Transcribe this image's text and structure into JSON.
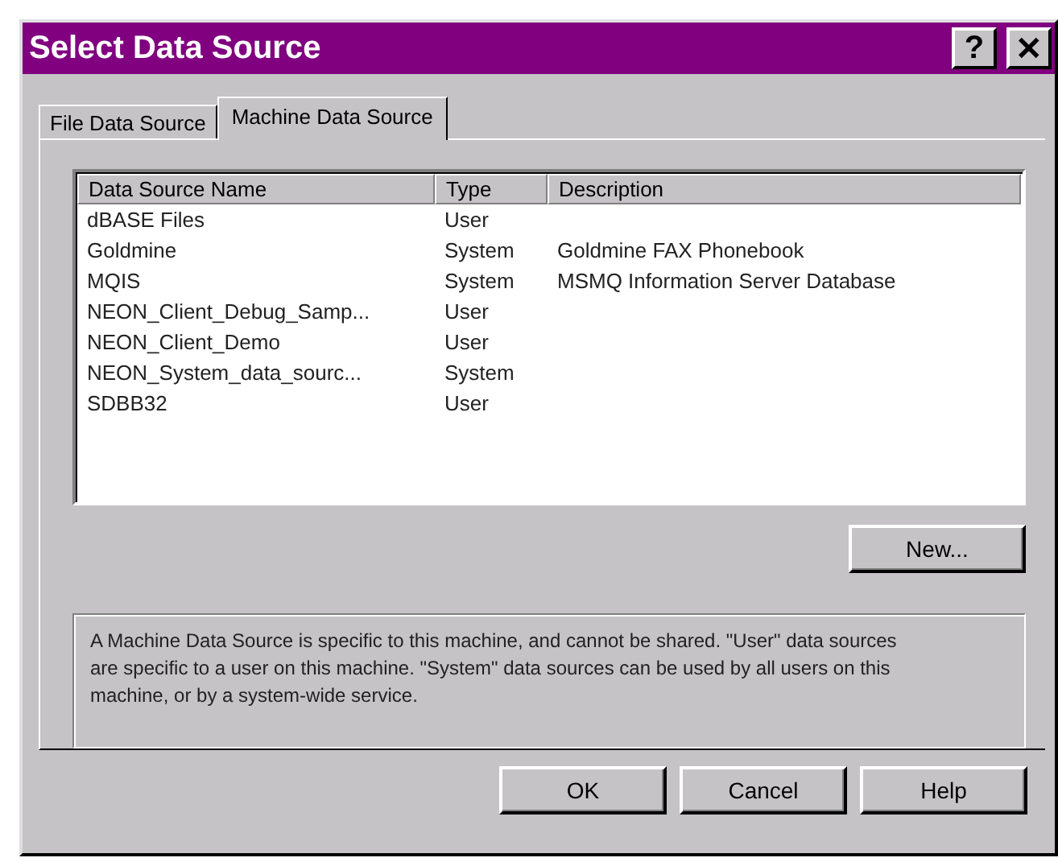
{
  "window": {
    "title": "Select Data Source",
    "title_buttons": [
      "?",
      "✕"
    ]
  },
  "tabs": [
    {
      "label": "File Data Source",
      "selected": false
    },
    {
      "label": "Machine Data Source",
      "selected": true
    }
  ],
  "table": {
    "columns": [
      "Data Source Name",
      "Type",
      "Description"
    ],
    "rows": [
      [
        "dBASE Files",
        "User",
        ""
      ],
      [
        "Goldmine",
        "System",
        "Goldmine FAX Phonebook"
      ],
      [
        "MQIS",
        "System",
        "MSMQ Information Server Database"
      ],
      [
        "NEON_Client_Debug_Samp...",
        "User",
        ""
      ],
      [
        "NEON_Client_Demo",
        "User",
        ""
      ],
      [
        "NEON_System_data_sourc...",
        "System",
        ""
      ],
      [
        "SDBB32",
        "User",
        ""
      ]
    ]
  },
  "new_button": "New...",
  "description": "A Machine Data Source is specific to this machine, and cannot be shared. \"User\" data sources are specific to a user on this machine.  \"System\" data sources can be used by all users on this machine, or by a system-wide service.",
  "buttons": [
    "OK",
    "Cancel",
    "Help"
  ]
}
